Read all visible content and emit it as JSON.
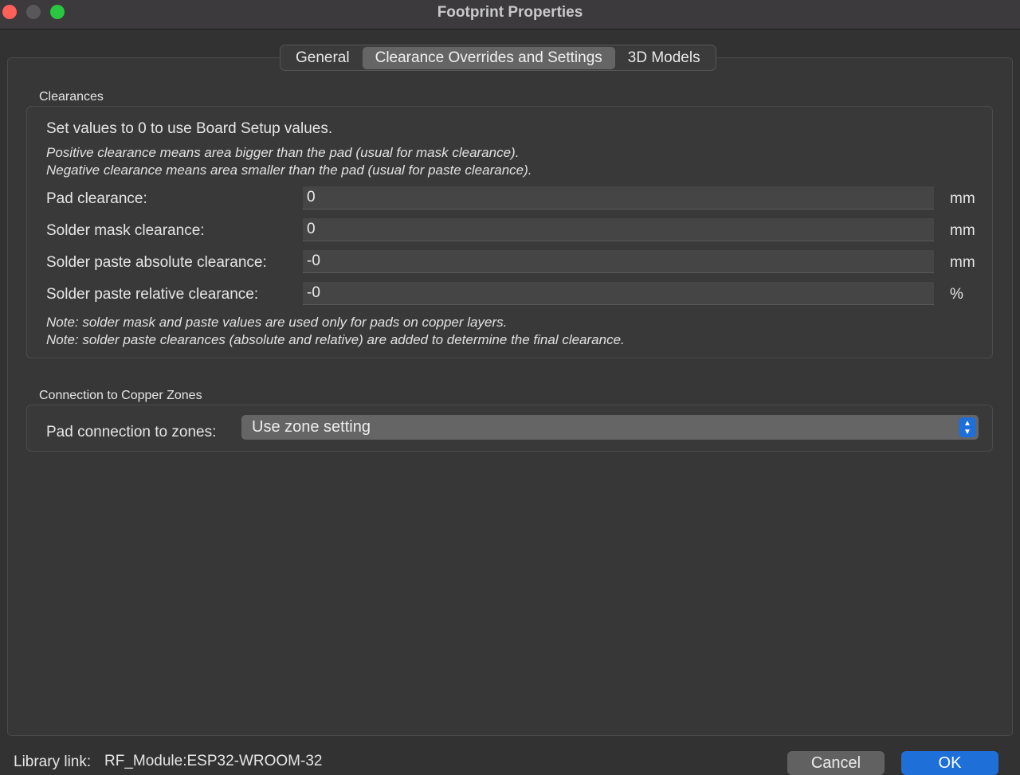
{
  "window": {
    "title": "Footprint Properties"
  },
  "tabs": [
    {
      "label": "General",
      "active": false
    },
    {
      "label": "Clearance Overrides and Settings",
      "active": true
    },
    {
      "label": "3D Models",
      "active": false
    }
  ],
  "clearances": {
    "group_label": "Clearances",
    "intro": "Set values to 0 to use Board Setup values.",
    "hint1": "Positive clearance means area bigger than the pad (usual for mask clearance).",
    "hint2": "Negative clearance means area smaller than the pad (usual for paste clearance).",
    "rows": [
      {
        "label": "Pad clearance:",
        "value": "0",
        "unit": "mm"
      },
      {
        "label": "Solder mask clearance:",
        "value": "0",
        "unit": "mm"
      },
      {
        "label": "Solder paste absolute clearance:",
        "value": "-0",
        "unit": "mm"
      },
      {
        "label": "Solder paste relative clearance:",
        "value": "-0",
        "unit": "%"
      }
    ],
    "note1": "Note: solder mask and paste values are used only for pads on copper layers.",
    "note2": "Note: solder paste clearances (absolute and relative) are added to determine the final clearance."
  },
  "zones": {
    "group_label": "Connection to Copper Zones",
    "pad_connection_label": "Pad connection to zones:",
    "pad_connection_value": "Use zone setting"
  },
  "footer": {
    "library_link_label": "Library link:",
    "library_link_value": "RF_Module:ESP32-WROOM-32",
    "cancel_label": "Cancel",
    "ok_label": "OK"
  },
  "colors": {
    "accent": "#1f6fd9",
    "close": "#fe5f57",
    "maximize": "#2ac840"
  }
}
